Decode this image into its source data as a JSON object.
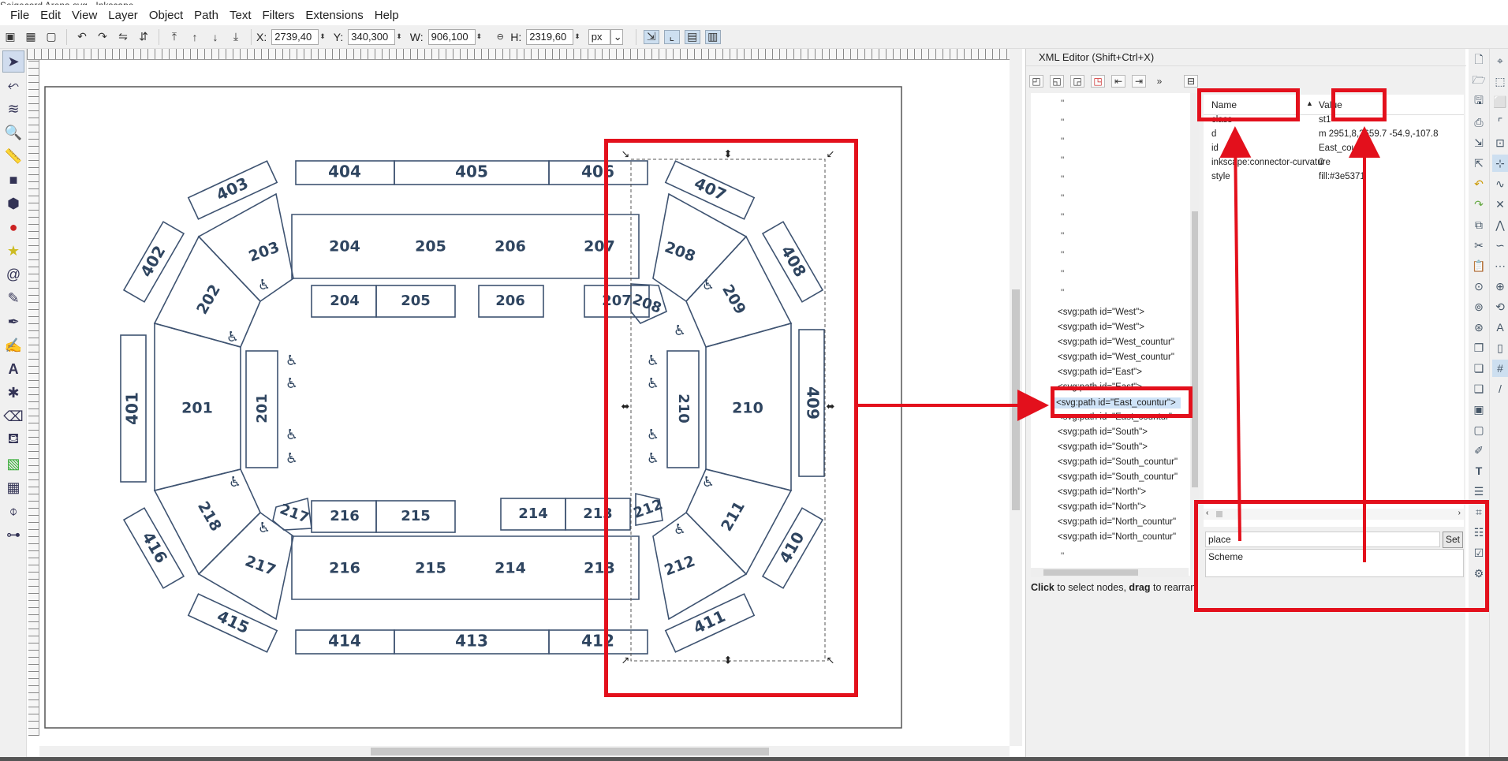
{
  "window": {
    "title": "Seigecord Arena.svg - Inkscape"
  },
  "menu": [
    "File",
    "Edit",
    "View",
    "Layer",
    "Object",
    "Path",
    "Text",
    "Filters",
    "Extensions",
    "Help"
  ],
  "toolbar": {
    "x_label": "X:",
    "x_value": "2739,40",
    "y_label": "Y:",
    "y_value": "340,300",
    "w_label": "W:",
    "w_value": "906,100",
    "h_label": "H:",
    "h_value": "2319,60",
    "unit": "px"
  },
  "canvas": {
    "sections_400": [
      "404",
      "405",
      "406",
      "403",
      "407",
      "402",
      "408",
      "401",
      "409",
      "416",
      "410",
      "415",
      "411",
      "414",
      "413",
      "412"
    ],
    "sections_200": [
      "204",
      "205",
      "206",
      "207",
      "203",
      "208",
      "202",
      "209",
      "201",
      "210",
      "218",
      "211",
      "217",
      "212",
      "216",
      "215",
      "214",
      "213"
    ],
    "inner_labels": [
      "204",
      "205",
      "206",
      "207",
      "208",
      "201",
      "210",
      "217",
      "216",
      "215",
      "214",
      "213",
      "212"
    ],
    "accessibility_icon": "♿"
  },
  "xml_editor": {
    "title": "XML Editor (Shift+Ctrl+X)",
    "nodes": [
      "<svg:path id=\"West\">",
      "<svg:path id=\"West\">",
      "<svg:path id=\"West_countur\"",
      "<svg:path id=\"West_countur\"",
      "<svg:path id=\"East\">",
      "<svg:path id=\"East\">",
      "<svg:path id=\"East_countur\">",
      "<svg:path id=\"East_countur\"",
      "<svg:path id=\"South\">",
      "<svg:path id=\"South\">",
      "<svg:path id=\"South_countur\"",
      "<svg:path id=\"South_countur\"",
      "<svg:path id=\"North\">",
      "<svg:path id=\"North\">",
      "<svg:path id=\"North_countur\"",
      "<svg:path id=\"North_countur\""
    ],
    "ditto": "\"",
    "hint_bold": "Click",
    "hint_1": " to select nodes, ",
    "hint_bold2": "drag",
    "hint_2": " to rearrange.",
    "col_name": "Name",
    "col_value": "Value",
    "attributes": [
      {
        "name": "class",
        "value": "st1"
      },
      {
        "name": "d",
        "value": "m 2951,8,2659.7 -54.9,-107.8"
      },
      {
        "name": "id",
        "value": "East_countur"
      },
      {
        "name": "inkscape:connector-curvature",
        "value": "0"
      },
      {
        "name": "style",
        "value": "fill:#3e5371"
      }
    ],
    "attr_name_input": "place",
    "set_button": "Set",
    "attr_value_input": "Scheme"
  },
  "colors": {
    "accent": "#e3101c",
    "seat_stroke": "#3e5371",
    "seat_text": "#2f4560"
  }
}
